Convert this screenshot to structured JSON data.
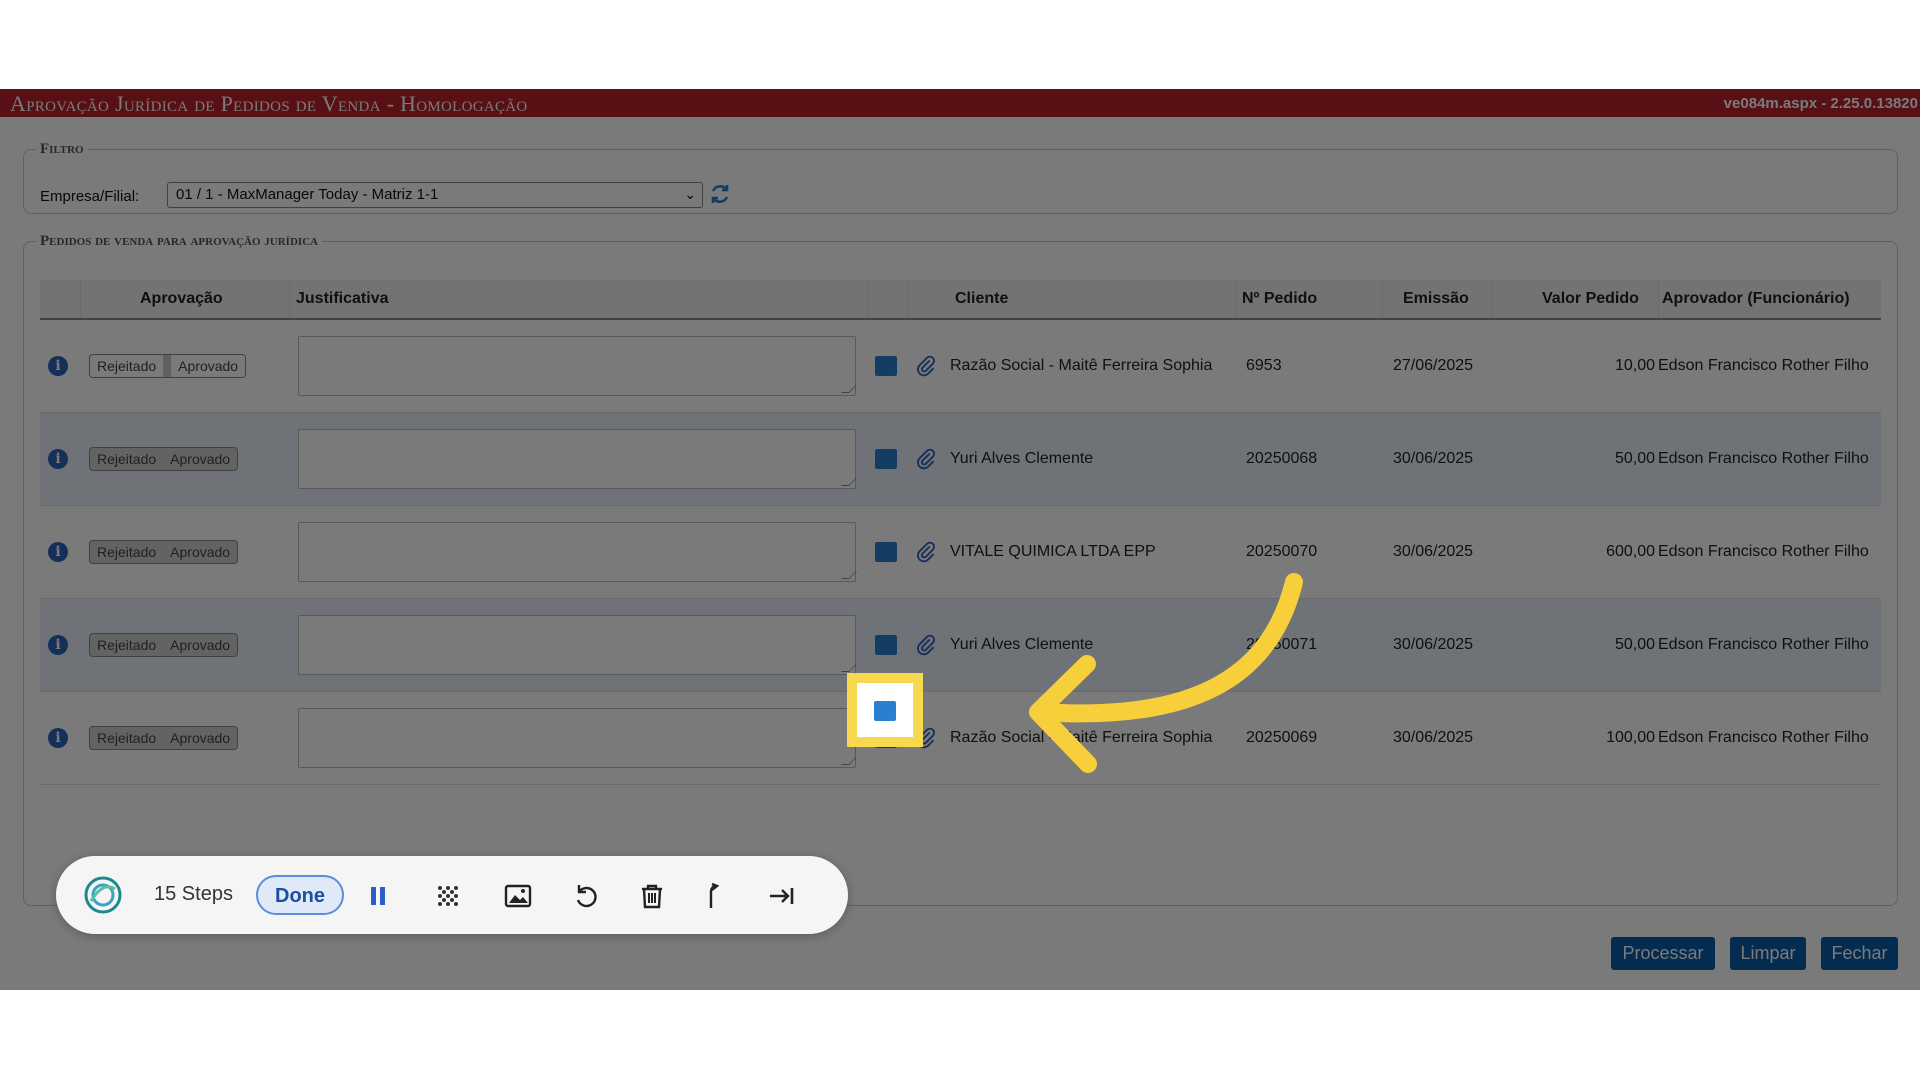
{
  "app": {
    "title": "Aprovação Jurídica de Pedidos de Venda  - Homologação",
    "version": "ve084m.aspx - 2.25.0.13820"
  },
  "filter": {
    "legend": "Filtro",
    "label": "Empresa/Filial:",
    "selected": "01 / 1 - MaxManager Today - Matriz 1-1"
  },
  "orders": {
    "legend": "Pedidos de venda para aprovação jurídica",
    "columns": [
      "Aprovação",
      "Justificativa",
      "Cliente",
      "Nº Pedido",
      "Emissão",
      "Valor Pedido",
      "Aprovador (Funcionário)"
    ],
    "toggle": {
      "rejected": "Rejeitado",
      "approved": "Aprovado"
    },
    "rows": [
      {
        "cliente": "Razão Social - Maitê Ferreira Sophia",
        "pedido": "6953",
        "emissao": "27/06/2025",
        "valor": "10,00",
        "aprovador": "Edson Francisco Rother Filho"
      },
      {
        "cliente": "Yuri Alves Clemente",
        "pedido": "20250068",
        "emissao": "30/06/2025",
        "valor": "50,00",
        "aprovador": "Edson Francisco Rother Filho"
      },
      {
        "cliente": "VITALE QUIMICA LTDA EPP",
        "pedido": "20250070",
        "emissao": "30/06/2025",
        "valor": "600,00",
        "aprovador": "Edson Francisco Rother Filho"
      },
      {
        "cliente": "Yuri Alves Clemente",
        "pedido": "20250071",
        "emissao": "30/06/2025",
        "valor": "50,00",
        "aprovador": "Edson Francisco Rother Filho"
      },
      {
        "cliente": "Razão Social - Maitê Ferreira Sophia",
        "pedido": "20250069",
        "emissao": "30/06/2025",
        "valor": "100,00",
        "aprovador": "Edson Francisco Rother Filho"
      }
    ]
  },
  "buttons": {
    "process": "Processar",
    "clear": "Limpar",
    "close": "Fechar"
  },
  "recorder": {
    "steps": "15 Steps",
    "done": "Done"
  },
  "colors": {
    "titlebar": "#b8232b",
    "accent": "#0a5aa8",
    "highlight": "#f6d94f",
    "arrow": "#f6cf3a"
  }
}
